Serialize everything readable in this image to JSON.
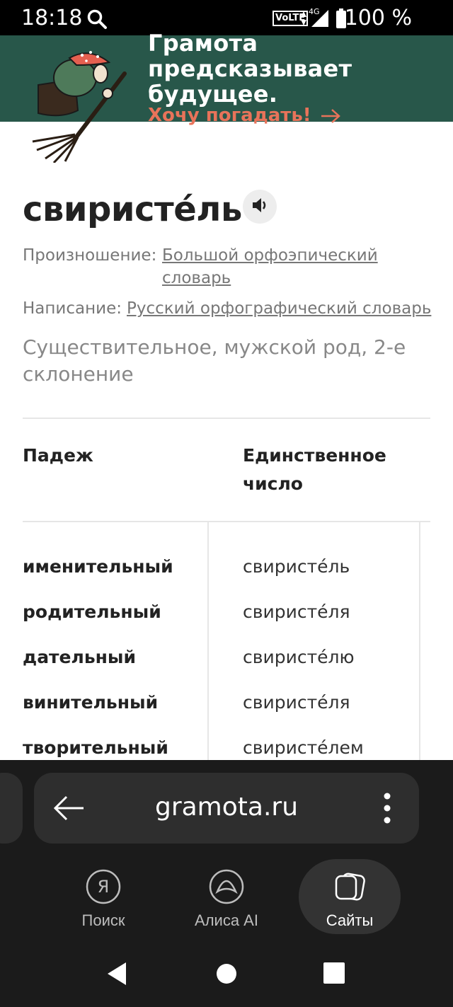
{
  "status_bar": {
    "time": "18:18",
    "volte": "VoLTE",
    "network": "4G",
    "battery": "100 %"
  },
  "banner": {
    "line1": "Грамота",
    "line2": "предсказывает",
    "line3": "будущее.",
    "cta": "Хочу погадать!",
    "bg_color": "#28574a",
    "cta_color": "#e8735a"
  },
  "entry": {
    "headword": "свиристе́ль",
    "pronunciation_label": "Произношение:",
    "pronunciation_link_line1": "Большой орфоэпический",
    "pronunciation_link_line2": "словарь",
    "spelling_label": "Написание:",
    "spelling_link": "Русский орфографический словарь",
    "part_of_speech": "Существительное, мужской род, 2-е склонение"
  },
  "declension": {
    "col_case": "Падеж",
    "col_singular_line1": "Единственное",
    "col_singular_line2": "число",
    "rows": [
      {
        "case": "именительный",
        "form": "свиристе́ль"
      },
      {
        "case": "родительный",
        "form": "свиристе́ля"
      },
      {
        "case": "дательный",
        "form": "свиристе́лю"
      },
      {
        "case": "винительный",
        "form": "свиристе́ля"
      },
      {
        "case": "творительный",
        "form": "свиристе́лем"
      }
    ]
  },
  "browser": {
    "url": "gramota.ru",
    "tabs": [
      {
        "label": "Поиск",
        "icon": "yandex-icon"
      },
      {
        "label": "Алиса AI",
        "icon": "alice-icon"
      },
      {
        "label": "Сайты",
        "icon": "tabs-icon",
        "active": true
      }
    ]
  }
}
